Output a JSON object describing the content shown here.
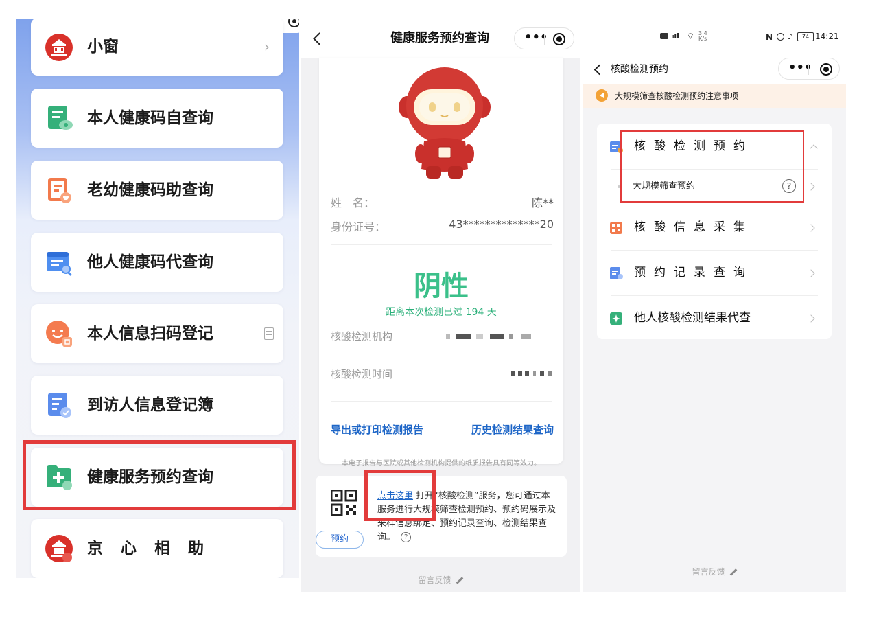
{
  "panel1": {
    "items": [
      {
        "label": "小窗",
        "trailing": "›"
      },
      {
        "label": "本人健康码自查询"
      },
      {
        "label": "老幼健康码助查询"
      },
      {
        "label": "他人健康码代查询"
      },
      {
        "label": "本人信息扫码登记"
      },
      {
        "label": "到访人信息登记簿"
      },
      {
        "label": "健康服务预约查询"
      },
      {
        "label": "京心相助"
      }
    ],
    "capsule_dots": "•••"
  },
  "panel2": {
    "title": "健康服务预约查询",
    "capsule_dots": "•••",
    "name_label": "姓　名：",
    "name_value": "陈**",
    "id_label": "身份证号：",
    "id_value": "43**************20",
    "result": "阴性",
    "days_since": "距离本次检测已过 194 天",
    "org_label": "核酸检测机构",
    "time_label": "核酸检测时间",
    "export_link": "导出或打印检测报告",
    "history_link": "历史检测结果查询",
    "disclaimer": "本电子报告与医院或其他检测机构提供的纸质报告具有同等效力。",
    "service": {
      "link_text": "点击这里",
      "description": "打开“核酸检测”服务，您可通过本服务进行大规模筛查检测预约、预约码展示及采样信息绑定、预约记录查询、检测结果查询。",
      "help": "?",
      "badge": "预约"
    },
    "feedback": "留言反馈"
  },
  "panel3": {
    "status_time": "14:21",
    "status_speed": "3.4\nK/s",
    "battery": "74",
    "nav_title": "核酸检测预约",
    "capsule_dots": "•••",
    "notice": "大规模筛查核酸检测预约注意事项",
    "menu": [
      {
        "label": "核酸检测预约"
      },
      {
        "label": "核酸信息采集"
      },
      {
        "label": "预约记录查询"
      },
      {
        "label": "他人核酸检测结果代查"
      }
    ],
    "sub_item": "大规模筛查预约",
    "help": "?",
    "feedback": "留言反馈"
  },
  "colors": {
    "highlight": "#e23b3b",
    "link": "#1e66c7",
    "negative_green": "#3bc08a",
    "notice_bg": "#fdf1e7"
  }
}
